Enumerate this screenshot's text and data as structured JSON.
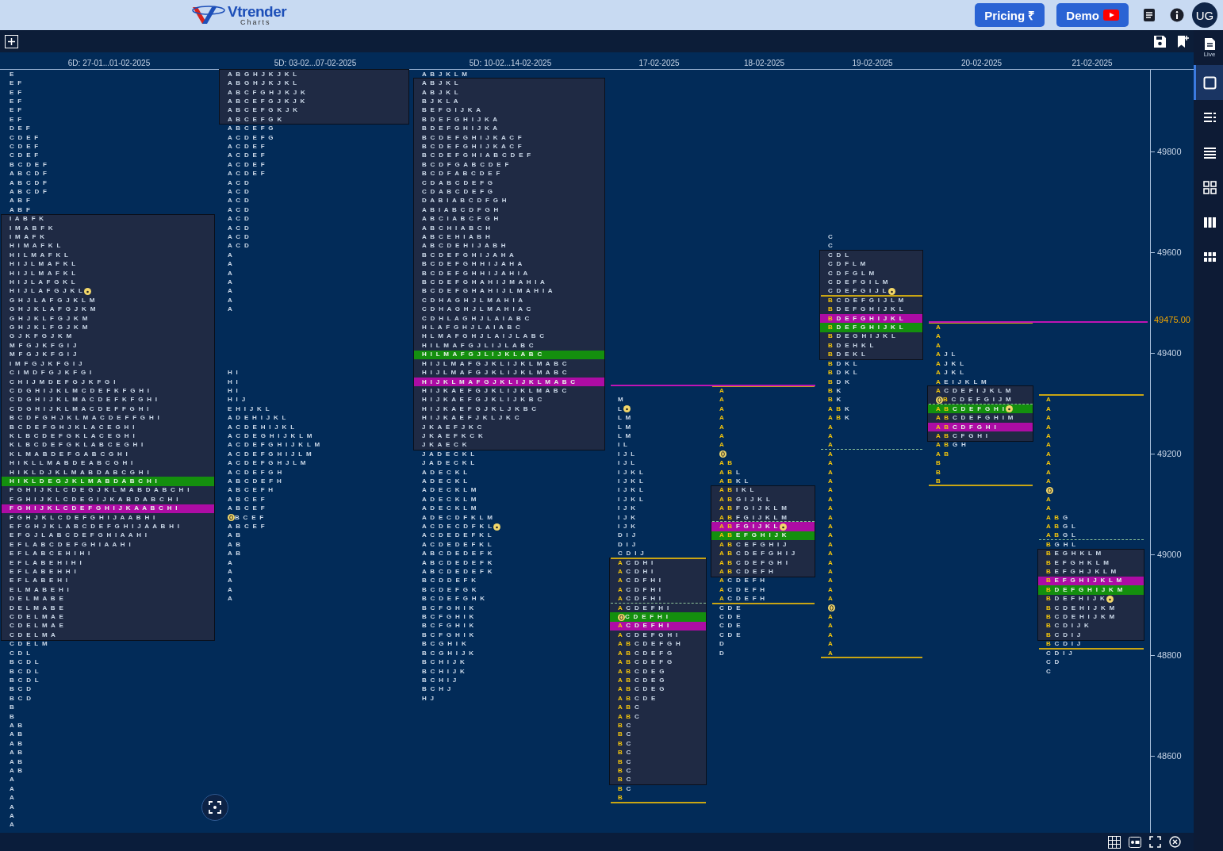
{
  "header": {
    "logo": {
      "name": "Vtrender",
      "tagline": "Charts"
    },
    "buttons": [
      {
        "kind": "pricing",
        "label": "Pricing ₹"
      },
      {
        "kind": "demo",
        "label": "Demo"
      }
    ],
    "avatar": "UG"
  },
  "sidebar": {
    "items": [
      {
        "label": "Live",
        "selected": false
      },
      {
        "selected": true
      },
      {
        "selected": false
      },
      {
        "selected": false
      },
      {
        "selected": false
      },
      {
        "selected": false
      },
      {
        "selected": false
      }
    ]
  },
  "chart": {
    "axis": [
      "49800",
      "49600",
      "49400",
      "49200",
      "49000",
      "48800",
      "48600"
    ],
    "price_tag": "49475.00",
    "columns": [
      {
        "title": "6D: 27-01...01-02-2025",
        "kind": "composite",
        "blocks": [
          {
            "kind": "plain",
            "rows": [
              "E",
              "E F",
              "E F",
              "E F",
              "E F",
              "E F",
              "D E F",
              "C D E F",
              "C D E F",
              "C D E F",
              "B C D E F",
              "A B C D F",
              "A B C D F",
              "A B C D F",
              "A B F",
              "A B F"
            ]
          },
          {
            "kind": "value_area",
            "rows": [
              "I A B F K",
              "I M A B F K",
              "I M A F K",
              "H I M A F K L",
              "H I L M A F K L",
              "H I J L M A F K L",
              "H I J L M A F K L",
              "H I J L A F G K L",
              {
                "text": "H I J L A F G J K L",
                "kind": "marked"
              },
              "G H J L A F G J K L M",
              "G H J K L A F G J K M",
              "G H J K L F G J K M",
              "G H J K L F G J K M",
              "G J K F G J K M",
              "M F G J K F G I J",
              "M F G J K F G I J",
              "I M F G J K F G I J",
              "C I M D F G J K F G I",
              "C H I J M D E F G J K F G I",
              "C D G H I J K L M C D E F K F G H I",
              "C D G H I J K L M A C D E F K F G H I",
              "C D G H I J K L M A C D E F F G H I",
              "B C D F G H J K L M A C D E F F G H I",
              "B C D E F G H J K L A C E G H I",
              "K L B C D E F G K L A C E G H I",
              "K L B C D E F G K L A B C E G H I",
              "K L M A B D E F G A B C G H I",
              "H I K L L M A B D E A B C G H I",
              "H I K L D J K L M A B D A B C G H I",
              {
                "text": "H I K L D E G J K L M A B D A B C H I",
                "kind": "poc"
              },
              "F G H I J K L C D E G J K L M A B D A B C H I",
              "F G H I J K L C D E G I J K A B D A B C H I",
              {
                "text": "F G H I J K L C D E F G H I J K A A B C H I",
                "kind": "vwap"
              },
              "F G H J K L C D E F G H I J A A B H I",
              "E F G H J K L A B C D E F G H I J A A B H I",
              "E F G J L A B C D E F G H I A A H I",
              "E F L A B C D E F G H I A A H I",
              "E F L A B C E H I H I",
              "E F L A B E H I H I",
              "E F L A B E H H I",
              "E F L A B E H I",
              "E L M A B E H I",
              "D E L M A B E",
              "D E L M A B E",
              "C D E L M A E",
              "C D E L M A E",
              "C D E L M A"
            ]
          },
          {
            "kind": "plain",
            "rows": [
              "C D E L M",
              "C D L",
              "B C D L",
              "B C D L",
              "B C D L",
              "B C D",
              "B C D",
              "B",
              "B",
              "A B",
              "A B",
              "A B",
              "A B",
              "A B",
              "A B",
              "A",
              "A",
              "A",
              "A",
              "A",
              "A"
            ]
          }
        ]
      },
      {
        "title": "5D: 03-02...07-02-2025",
        "kind": "composite",
        "blocks": [
          {
            "kind": "value_area",
            "rows": [
              "A B G H J K J K L",
              "A B G H J K J K L",
              "A B C F G H J K J K",
              "A B C E F G J K J K",
              "A B C E F G K J K",
              "A B C E F G K"
            ]
          },
          {
            "kind": "plain",
            "rows": [
              "A B C E F G",
              "A C D E F G",
              "A C D E F",
              "A C D E F",
              "A C D E F",
              "A C D E F",
              "A C D",
              "A C D",
              "A C D",
              "A C D",
              "A C D",
              "A C D",
              "A C D",
              "A C D",
              "A",
              "A",
              "A",
              "A",
              "A",
              "A",
              "A"
            ]
          },
          {
            "kind": "plain",
            "rows": [
              "H I",
              "H I",
              "H I",
              "H I J",
              "E H I J K L",
              "A D E H I J K L",
              "A C D E H I J K L",
              "A C D E G H I J K L M",
              "A C D E F G H I J K L M",
              "A C D E F G H I J L M",
              "A C D E F G H J L M",
              "A C D E F G H",
              "A B C D E F H",
              "A B C E F H",
              "A B C E F",
              "A B C E F",
              {
                "text": "B C E F",
                "kind": "opened"
              },
              "A B C E F",
              "A B",
              "A B",
              "A B",
              "A",
              "A",
              "A",
              "A",
              "A"
            ]
          }
        ]
      },
      {
        "title": "5D: 10-02...14-02-2025",
        "kind": "composite",
        "blocks": [
          {
            "kind": "plain",
            "rows": [
              "A B J K L M"
            ]
          },
          {
            "kind": "value_area",
            "rows": [
              "A B J K L",
              "A B J K L",
              "B J K L A",
              "B E F G I J K A",
              "B D E F G H I J K A",
              "B D E F G H I J K A",
              "B C D E F G H I J K A C F",
              "B C D E F G H I J K A C F",
              "B C D E F G H I A B C D E F",
              "B C D F G A B C D E F",
              "B C D F A B C D E F",
              "C D A B C D E F G",
              "C D A B C D E F G",
              "D A B I A B C D F G H",
              "A B I A B C D F G H",
              "A B C I A B C F G H",
              "A B C H I A B C H",
              "A B C E H I A B H",
              "A B C D E H I J A B H",
              "B C D E F G H I J A H A",
              "B C D E F G H H I J A H A",
              "B C D E F G H H I J A H I A",
              "B C D E F G H A H I J M A H I A",
              "B C D E F G H A H I J L M A H I A",
              "C D H A G H J L M A H I A",
              "C D H A G H J L M A H I A C",
              "C D H L A G H J L A I A B C",
              "H L A F G H J L A I A B C",
              "H L M A F G H J L A I J L A B C",
              "H I L M A F G J L I J L A B C",
              {
                "text": "H I L M A F G J L I J K L A B C",
                "kind": "poc"
              },
              "H I J L M A F G J K L I J K L M A B C",
              "H I J L M A F G J K L I J K L M A B C",
              {
                "text": "H I J K L M A F G J K L I J K L M A B C",
                "kind": "vwap"
              },
              "H I J K A E F G J K L I J K L M A B C",
              "H I J K A E F G J K L I J K B C",
              "H I J K A E F G J K L J K B C",
              "H I J K A E F J K L J K C",
              "J K A E F J K C",
              "J K A E F K C K",
              "J K A E C K"
            ]
          },
          {
            "kind": "plain",
            "rows": [
              "J A D E C K L",
              "J A D E C K L",
              "A D E C K L",
              "A D E C K L",
              "A D E C K L M",
              "A D E C K L M",
              "A D E C K L M",
              "A D E C D F K L M",
              {
                "text": "A C D E C D F K L",
                "kind": "marked"
              },
              "A C D E D E F K L",
              "A C D E D E F K L",
              "A B C D E D E F K",
              "A B C D E D E F K",
              "A B C D E D E F K",
              "B C D D E F K",
              "B C D E F G K",
              "B C D E F G H K",
              "B C F G H I K",
              "B C F G H I K",
              "B C F G H I K",
              "B C F G H I K",
              "B C G H I K",
              "B C G H I J K",
              "B C H I J K",
              "B C H I J K",
              "B C H I J",
              "B C H J",
              "H J"
            ]
          }
        ]
      },
      {
        "title": "17-02-2025",
        "kind": "daily",
        "blocks": [
          {
            "kind": "plain",
            "rows": [
              "M",
              {
                "text": "L",
                "kind": "marked"
              },
              "L M",
              "L M",
              "L M",
              "I L",
              "I J L",
              "I J L",
              "I J K L",
              "I J K L",
              "I J K L",
              "I J K L",
              "I J K",
              "I J K",
              "I J K",
              "D I J",
              "D I J",
              "C D I J"
            ]
          },
          {
            "kind": "value_area",
            "rows": [
              "A C D H I",
              "A C D H I",
              "A C D F H I",
              "A C D F H I",
              "A C D F H I",
              "A C D E F H I",
              {
                "text": "C D E F H I",
                "kind": "poc-opened"
              },
              {
                "text": "A C D E F H I",
                "kind": "vwap"
              },
              "A C D E F G H I",
              "A B C D E F G H",
              "A B C D E F G",
              "A B C D E F G",
              "A B C D E G",
              "A B C D E G",
              "A B C D E G",
              "A B C D E",
              "A B C",
              "A B C",
              "B C",
              "B C",
              "B C",
              "B C",
              "B C",
              "B C",
              "B C"
            ]
          },
          {
            "kind": "plain",
            "rows": [
              "B C",
              "B"
            ]
          }
        ]
      },
      {
        "title": "18-02-2025",
        "kind": "daily",
        "blocks": [
          {
            "kind": "plain",
            "rows": [
              "A",
              "A",
              "A",
              "A",
              "A",
              "A",
              "A",
              {
                "kind": "opened"
              },
              "A B",
              "A B L",
              "A B K L"
            ]
          },
          {
            "kind": "value_area",
            "rows": [
              "A B I K L",
              "A B G I J K L",
              "A B F G I J K L M",
              "A B F G I J K L M",
              {
                "text": "A B F G I J K L",
                "kind": "vwap-marked"
              },
              {
                "text": "A B E F G H I J K",
                "kind": "poc"
              },
              "A B C E F G H I J",
              "A B C D E F G H I J",
              "A B C D E F G H I",
              "A B C D E F H"
            ]
          },
          {
            "kind": "plain",
            "rows": [
              "A C D E F H",
              "A C D E F H",
              "A C D E F H",
              "C D E",
              "C D E",
              "C D E",
              "C D E",
              "D",
              "D"
            ]
          }
        ]
      },
      {
        "title": "19-02-2025",
        "kind": "daily",
        "blocks": [
          {
            "kind": "plain",
            "rows": [
              "C",
              "C"
            ]
          },
          {
            "kind": "value_area",
            "rows": [
              "C D L",
              "C D F L M",
              "C D F G L M",
              "C D E F G I L M",
              {
                "text": "C D E F G I J L",
                "kind": "marked"
              },
              "B C D E F G I J L M",
              "B D E F G H I J K L",
              {
                "text": "B D E F G H I J K L",
                "kind": "vwap"
              },
              {
                "text": "B D E F G H I J K L",
                "kind": "poc"
              },
              "B D E G H I J K L",
              "B D E H K L",
              "B D E K L"
            ]
          },
          {
            "kind": "plain",
            "rows": [
              "B D K L",
              "B D K L",
              "B D K",
              "B K",
              "B K",
              "A B K",
              "A B K",
              "A",
              "A",
              "A",
              "A",
              "A",
              "A",
              "A",
              "A",
              "A",
              "A",
              "A",
              "A",
              "A",
              "A",
              "A",
              "A",
              "A",
              "A",
              "A",
              "A",
              {
                "kind": "opened"
              },
              "A",
              "A",
              "A",
              "A",
              "A"
            ]
          }
        ]
      },
      {
        "title": "20-02-2025",
        "kind": "daily",
        "blocks": [
          {
            "kind": "plain",
            "rows": [
              "A",
              "A",
              "A",
              "A J L",
              "A J K L",
              "A J K L",
              "A E I J K L M"
            ]
          },
          {
            "kind": "value_area",
            "rows": [
              "A C D E F I J K L M",
              {
                "text": "B C D E F G I J M",
                "kind": "opened"
              },
              {
                "text": "A B C D E F G H I",
                "kind": "poc-marked"
              },
              "A B C D E F G H I M",
              {
                "text": "A B C D F G H I",
                "kind": "vwap"
              },
              "A B C F G H I"
            ]
          },
          {
            "kind": "plain",
            "rows": [
              "A B G H",
              "A B",
              "B",
              "B",
              "B"
            ]
          }
        ]
      },
      {
        "title": "21-02-2025",
        "kind": "daily",
        "blocks": [
          {
            "kind": "plain",
            "rows": [
              "A",
              "A",
              "A",
              "A",
              "A",
              "A",
              "A",
              "A",
              "A",
              "A",
              {
                "kind": "opened"
              },
              "A",
              "A",
              "A B G",
              "A B G L",
              "A B G L",
              "B G H L"
            ]
          },
          {
            "kind": "value_area",
            "rows": [
              "B E G H K L M",
              "B E F G H K L M",
              "B E F G H J K L M",
              {
                "text": "B E F G H I J K L M",
                "kind": "vwap"
              },
              {
                "text": "B D E F G H I J K M",
                "kind": "poc"
              },
              {
                "text": "B D E F H I J K",
                "kind": "marked"
              },
              "B C D E H I J K M",
              "B C D E H I J K M",
              "B C D I J K",
              "B C D I J"
            ]
          },
          {
            "kind": "plain",
            "rows": [
              "B C D I J",
              "C D I J",
              "C D",
              "C"
            ]
          }
        ]
      }
    ]
  }
}
